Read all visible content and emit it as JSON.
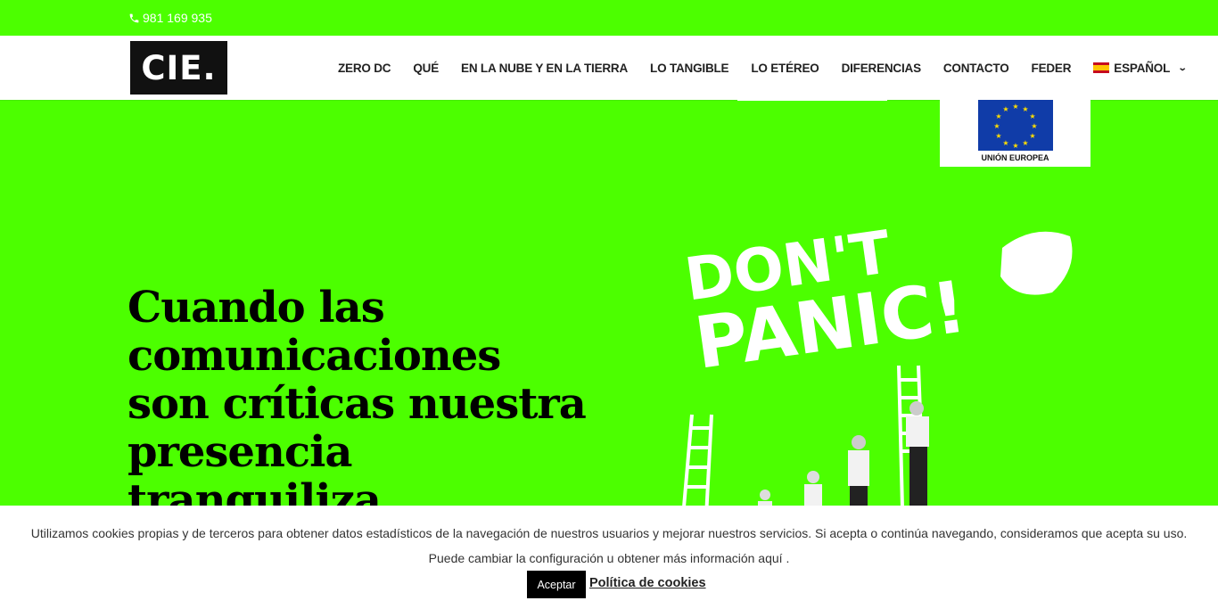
{
  "topbar": {
    "phone": "981 169 935",
    "icon": "phone-icon"
  },
  "header": {
    "logo_text": "CIE.",
    "nav": [
      "ZERO DC",
      "QUÉ",
      "EN LA NUBE Y EN LA TIERRA",
      "LO TANGIBLE",
      "LO ETÉREO",
      "DIFERENCIAS",
      "CONTACTO",
      "FEDER"
    ],
    "language": {
      "label": "ESPAÑOL",
      "flag_icon": "spain-flag-icon",
      "chevron": "chevron-down-icon"
    }
  },
  "eu_badge": {
    "label": "UNIÓN EUROPEA"
  },
  "hero": {
    "title": "Cuando las comunicaciones son críticas nuestra presencia tranquiliza",
    "illustration_text_line1": "DON'T",
    "illustration_text_line2": "PANIC!"
  },
  "cookie": {
    "line1": "Utilizamos cookies propias y de terceros para obtener datos estadísticos de la navegación de nuestros usuarios y mejorar nuestros servicios. Si acepta o continúa navegando, consideramos que acepta su uso.",
    "line2": "Puede cambiar la configuración u obtener más información aquí .",
    "accept_label": "Aceptar",
    "policy_label": "Política de cookies"
  },
  "colors": {
    "brand_green": "#4cff00",
    "dark": "#000000",
    "eu_blue": "#103ca8"
  }
}
